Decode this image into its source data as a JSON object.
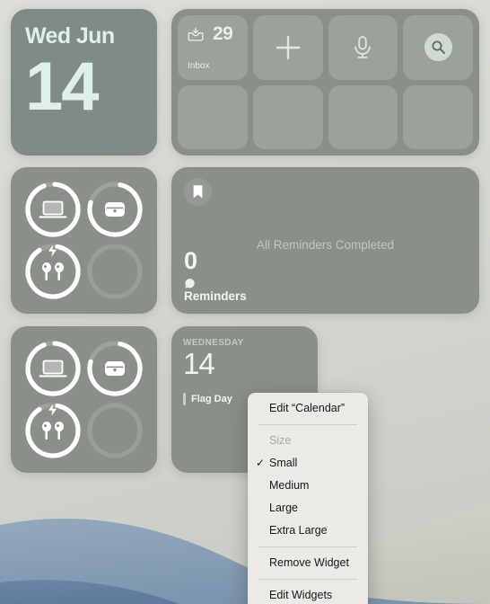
{
  "wallpaper": {
    "sky_color": "#d6d9d1",
    "wave_color": "#8ba2b8",
    "dune_color": "#cdd0c6"
  },
  "widgets": {
    "date": {
      "name": "Date",
      "day_of_week": "Wed Jun",
      "day_number": "14",
      "bg_color": "#808a87",
      "text_color": "#dff0ec"
    },
    "shortcuts": {
      "name": "Shortcuts",
      "bg_color": "#8b8f89",
      "tiles": [
        {
          "icon": "inbox-tray-icon",
          "count": "29",
          "label": "Inbox"
        },
        {
          "icon": "plus-icon",
          "count": "",
          "label": ""
        },
        {
          "icon": "microphone-icon",
          "count": "",
          "label": ""
        },
        {
          "icon": "search-icon",
          "count": "",
          "label": ""
        },
        {
          "icon": "empty-tile",
          "count": "",
          "label": ""
        },
        {
          "icon": "empty-tile",
          "count": "",
          "label": ""
        },
        {
          "icon": "empty-tile",
          "count": "",
          "label": ""
        },
        {
          "icon": "empty-tile",
          "count": "",
          "label": ""
        }
      ]
    },
    "batteries": {
      "name": "Batteries",
      "bg_color": "#8b8f89",
      "items": [
        {
          "device": "laptop-icon",
          "percent": 93,
          "charging": false
        },
        {
          "device": "airpods-case-icon",
          "percent": 76,
          "charging": false
        },
        {
          "device": "airpods-icon",
          "percent": 88,
          "charging": true
        },
        {
          "device": "empty-slot",
          "percent": 0,
          "charging": false
        }
      ]
    },
    "reminders": {
      "name": "Reminders",
      "bg_color": "#8b8f89",
      "bookmark_icon": "bookmark-icon",
      "count": "0",
      "list_name": "Reminders",
      "empty_message": "All Reminders Completed"
    },
    "calendar": {
      "name": "Calendar",
      "bg_color": "#8b8f89",
      "day_of_week": "WEDNESDAY",
      "day_number": "14",
      "event_title": "Flag Day"
    }
  },
  "context_menu": {
    "bg_color": "#eceae7",
    "items": [
      {
        "label": "Edit “Calendar”",
        "type": "item",
        "checked": false,
        "disabled": false
      },
      {
        "label": "",
        "type": "separator",
        "checked": false,
        "disabled": false
      },
      {
        "label": "Size",
        "type": "header",
        "checked": false,
        "disabled": true
      },
      {
        "label": "Small",
        "type": "item",
        "checked": true,
        "disabled": false
      },
      {
        "label": "Medium",
        "type": "item",
        "checked": false,
        "disabled": false
      },
      {
        "label": "Large",
        "type": "item",
        "checked": false,
        "disabled": false
      },
      {
        "label": "Extra Large",
        "type": "item",
        "checked": false,
        "disabled": false
      },
      {
        "label": "",
        "type": "separator",
        "checked": false,
        "disabled": false
      },
      {
        "label": "Remove Widget",
        "type": "item",
        "checked": false,
        "disabled": false
      },
      {
        "label": "",
        "type": "separator",
        "checked": false,
        "disabled": false
      },
      {
        "label": "Edit Widgets",
        "type": "item",
        "checked": false,
        "disabled": false
      }
    ],
    "check_glyph": "✓"
  }
}
